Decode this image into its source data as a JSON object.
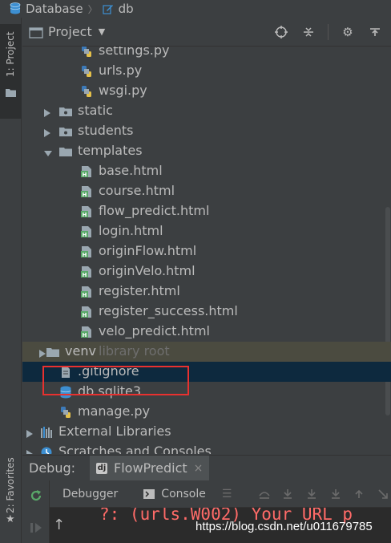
{
  "breadcrumb": {
    "items": [
      "Database",
      "db"
    ]
  },
  "left_stripe": {
    "project_tab": "1: Project",
    "favorites_tab": "2: Favorites"
  },
  "project_panel": {
    "title": "Project"
  },
  "tree": [
    {
      "label": "settings.py",
      "type": "py",
      "indent": 3,
      "partial": true
    },
    {
      "label": "urls.py",
      "type": "py",
      "indent": 3
    },
    {
      "label": "wsgi.py",
      "type": "py",
      "indent": 3
    },
    {
      "label": "static",
      "type": "folder-pkg",
      "indent": 2,
      "arrow": "right"
    },
    {
      "label": "students",
      "type": "folder-pkg",
      "indent": 2,
      "arrow": "right"
    },
    {
      "label": "templates",
      "type": "folder",
      "indent": 2,
      "arrow": "down"
    },
    {
      "label": "base.html",
      "type": "html",
      "indent": 3
    },
    {
      "label": "course.html",
      "type": "html",
      "indent": 3
    },
    {
      "label": "flow_predict.html",
      "type": "html",
      "indent": 3
    },
    {
      "label": "login.html",
      "type": "html",
      "indent": 3
    },
    {
      "label": "originFlow.html",
      "type": "html",
      "indent": 3
    },
    {
      "label": "originVelo.html",
      "type": "html",
      "indent": 3
    },
    {
      "label": "register.html",
      "type": "html",
      "indent": 3
    },
    {
      "label": "register_success.html",
      "type": "html",
      "indent": 3
    },
    {
      "label": "velo_predict.html",
      "type": "html",
      "indent": 3
    },
    {
      "label": "venv",
      "sublabel": "library root",
      "type": "folder",
      "indent": 1,
      "arrow": "right",
      "bg": "hover"
    },
    {
      "label": ".gitignore",
      "type": "text",
      "indent": 2,
      "bg": "selected"
    },
    {
      "label": "db.sqlite3",
      "type": "db",
      "indent": 2
    },
    {
      "label": "manage.py",
      "type": "py",
      "indent": 2
    },
    {
      "label": "External Libraries",
      "type": "lib",
      "indent": 0,
      "arrow": "right"
    },
    {
      "label": "Scratches and Consoles",
      "type": "scratch",
      "indent": 0,
      "arrow": "right"
    }
  ],
  "debug": {
    "label": "Debug:",
    "tab": "FlowPredict",
    "tab_close": "×",
    "tabs": [
      "Debugger",
      "Console"
    ],
    "console_text": "?: (urls.W002) Your URL p"
  },
  "watermark": "https://blog.csdn.net/u011679785",
  "colors": {
    "highlight": "#e8312f",
    "selected_row": "#0d293e",
    "hover_row": "#4b4b40",
    "error_text": "#ff6b68"
  }
}
